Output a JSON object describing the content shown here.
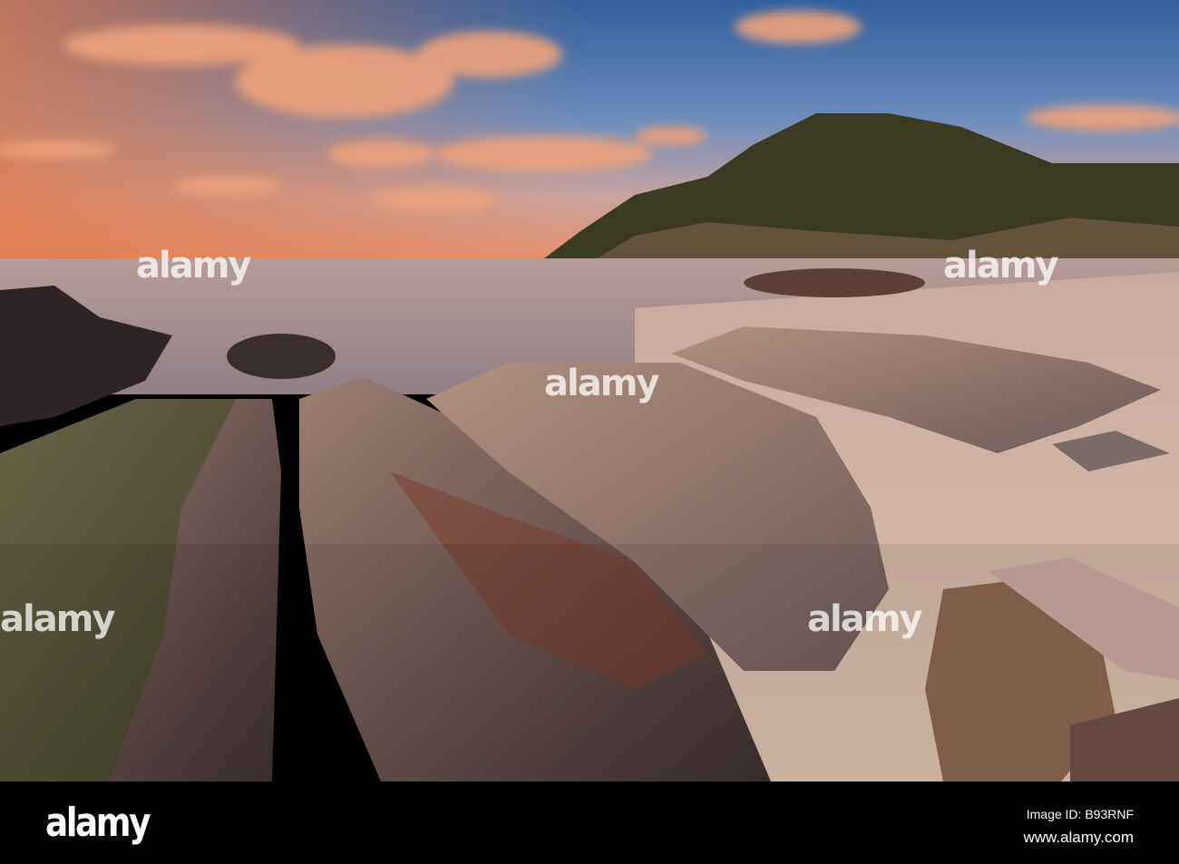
{
  "photo": {
    "subject": "Rocky beach at sunset with wooded headland",
    "colors": {
      "sky_top": "#3d6fb0",
      "sky_glow": "#e8895a",
      "cloud": "#f0a070",
      "sea": "#a89aa0",
      "rock": "#6e5a55",
      "sand": "#d8bfae",
      "moss": "#3f4a25",
      "headland": "#3a3a22"
    }
  },
  "watermark": {
    "text": "alamy"
  },
  "banner": {
    "logo": "alamy",
    "image_id": "Image ID: B93RNF",
    "website": "www.alamy.com"
  }
}
